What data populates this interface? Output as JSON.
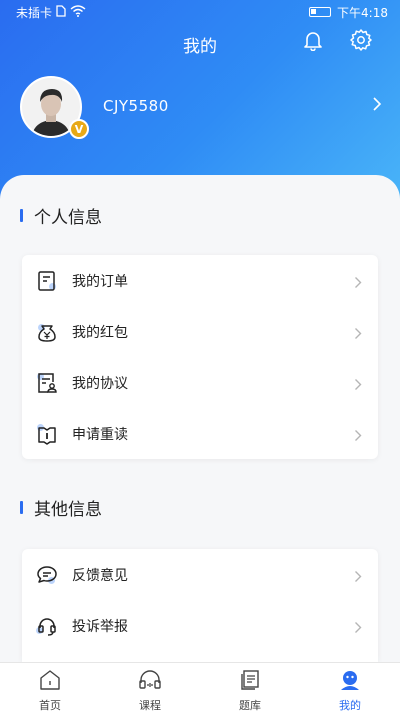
{
  "status": {
    "carrier": "未插卡",
    "time": "下午4:18"
  },
  "header": {
    "title": "我的"
  },
  "profile": {
    "username": "CJY5580",
    "badge": "V"
  },
  "sections": [
    {
      "title": "个人信息",
      "items": [
        {
          "label": "我的订单",
          "icon": "order-icon"
        },
        {
          "label": "我的红包",
          "icon": "red-packet-icon"
        },
        {
          "label": "我的协议",
          "icon": "agreement-icon"
        },
        {
          "label": "申请重读",
          "icon": "reread-icon"
        }
      ]
    },
    {
      "title": "其他信息",
      "items": [
        {
          "label": "反馈意见",
          "icon": "feedback-icon"
        },
        {
          "label": "投诉举报",
          "icon": "complaint-icon"
        }
      ]
    }
  ],
  "tabs": [
    {
      "label": "首页",
      "icon": "home-icon"
    },
    {
      "label": "课程",
      "icon": "course-icon"
    },
    {
      "label": "题库",
      "icon": "question-bank-icon"
    },
    {
      "label": "我的",
      "icon": "profile-icon",
      "active": true
    }
  ],
  "colors": {
    "accent": "#2a6cf0",
    "badge": "#e8a917"
  }
}
